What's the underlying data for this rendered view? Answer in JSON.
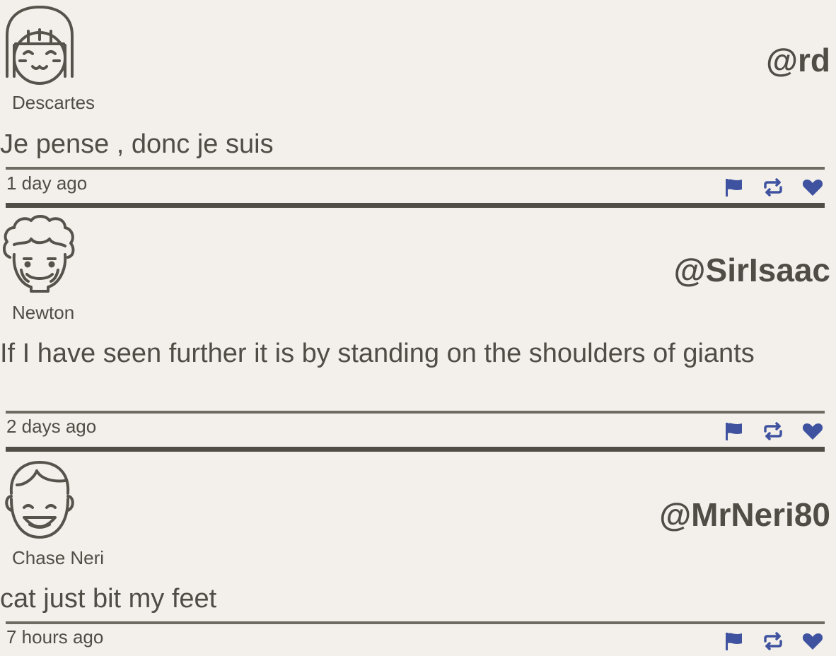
{
  "colors": {
    "background": "#f3f0eb",
    "text": "#4f4d46",
    "accent": "#3f52a0"
  },
  "tweets": [
    {
      "avatar_icon": "girl-face-icon",
      "display_name": "Descartes",
      "handle": "@rd",
      "message": "Je pense , donc je suis",
      "time": "1 day ago"
    },
    {
      "avatar_icon": "curly-hair-face-icon",
      "display_name": "Newton",
      "handle": "@SirIsaac",
      "message": "If I have seen further it is by standing on the shoulders of giants",
      "time": "2 days ago"
    },
    {
      "avatar_icon": "boy-face-icon",
      "display_name": "Chase Neri",
      "handle": "@MrNeri80",
      "message": "cat just bit my feet",
      "time": "7 hours ago"
    }
  ],
  "action_icons": [
    "flag-icon",
    "retweet-icon",
    "heart-icon"
  ]
}
